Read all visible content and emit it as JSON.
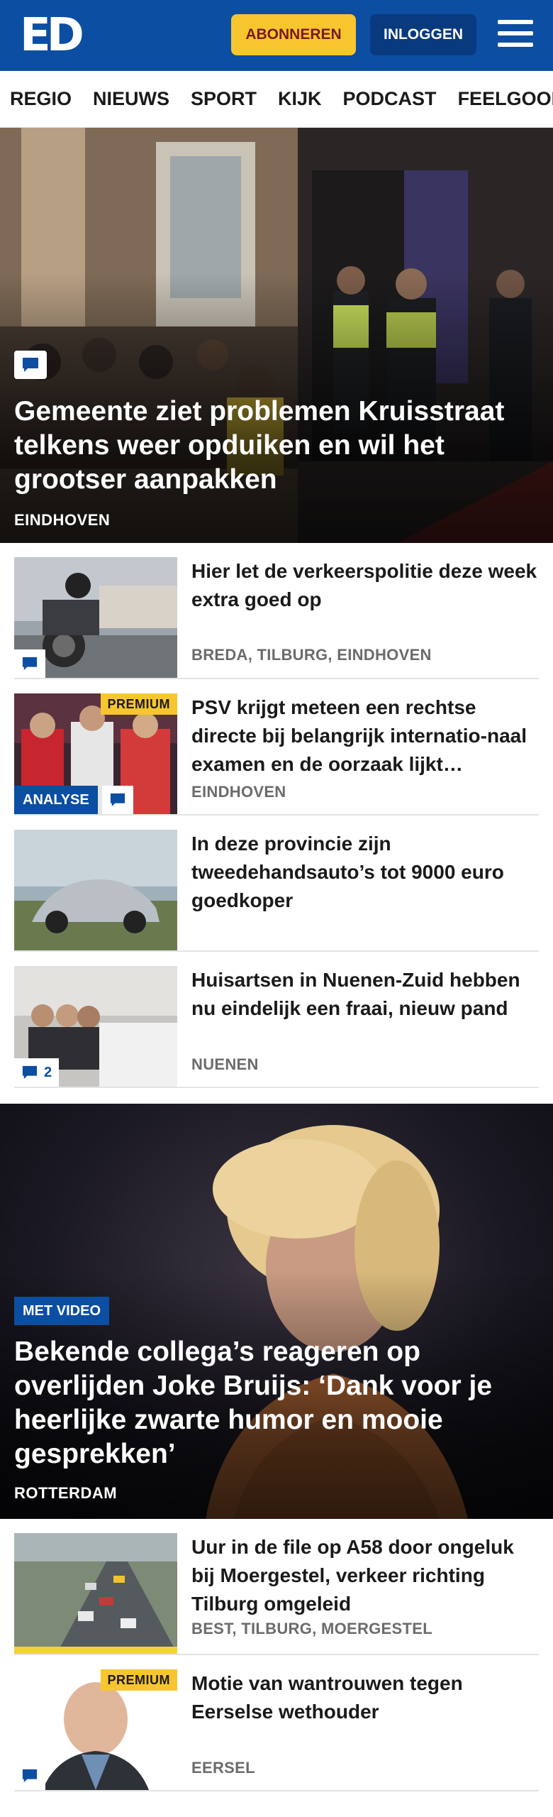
{
  "header": {
    "logo": "ED",
    "subscribe_label": "ABONNEREN",
    "login_label": "INLOGGEN",
    "menu_icon": "hamburger-menu-icon",
    "colors": {
      "brand": "#0b4ea2",
      "subscribe": "#f7c62f",
      "login": "#0a3a7e"
    }
  },
  "nav": {
    "items": [
      "REGIO",
      "NIEUWS",
      "SPORT",
      "KIJK",
      "PODCAST",
      "FEELGOOD"
    ]
  },
  "hero": {
    "title": "Gemeente ziet problemen Kruisstraat telkens weer opduiken en wil het grootser aanpakken",
    "location": "EINDHOVEN",
    "comment_icon": "comment-icon"
  },
  "articles": [
    {
      "title": "Hier let de verkeerspolitie deze week extra goed op",
      "location": "BREDA, TILBURG, EINDHOVEN"
    },
    {
      "title": "PSV krijgt meteen een rechtse directe bij belangrijk internatio-naal examen en de oorzaak lijkt…",
      "location": "EINDHOVEN",
      "premium": "PREMIUM",
      "label": "ANALYSE"
    },
    {
      "title": "In deze provincie zijn tweedehandsauto’s tot 9000 euro goedkoper",
      "location": ""
    },
    {
      "title": "Huisartsen in Nuenen-Zuid hebben nu eindelijk een fraai, nieuw pand",
      "location": "NUENEN",
      "comments": "2"
    }
  ],
  "feature": {
    "label": "MET VIDEO",
    "title": "Bekende collega’s reageren op overlijden Joke Bruijs: ‘Dank voor je heerlijke zwarte humor en mooie gesprekken’",
    "location": "ROTTERDAM"
  },
  "articles2": [
    {
      "title": "Uur in de file op A58 door ongeluk bij Moergestel, verkeer richting Tilburg omgeleid",
      "location": "BEST, TILBURG, MOERGESTEL"
    },
    {
      "title": "Motie van wantrouwen tegen Eerselse wethouder",
      "location": "EERSEL",
      "premium": "PREMIUM"
    }
  ]
}
